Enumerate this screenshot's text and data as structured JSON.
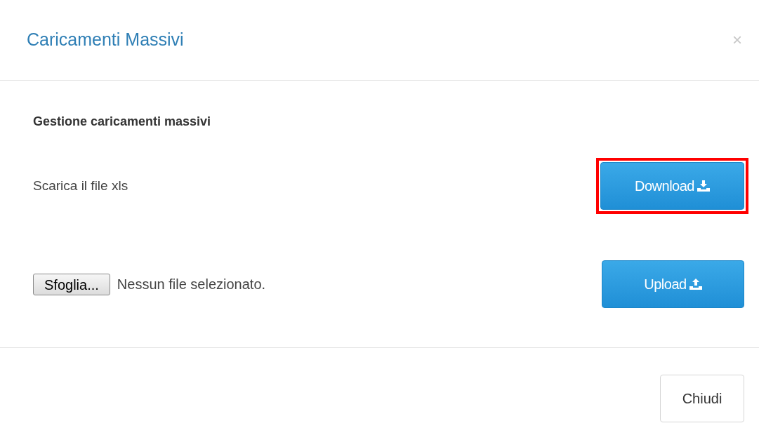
{
  "dialog": {
    "title": "Caricamenti Massivi",
    "close": "×"
  },
  "section_title": "Gestione caricamenti massivi",
  "download_row": {
    "label": "Scarica il file xls",
    "button": "Download",
    "highlighted": true
  },
  "upload_row": {
    "browse_button": "Sfoglia...",
    "file_status": "Nessun file selezionato.",
    "button": "Upload"
  },
  "footer_button": "Chiudi"
}
